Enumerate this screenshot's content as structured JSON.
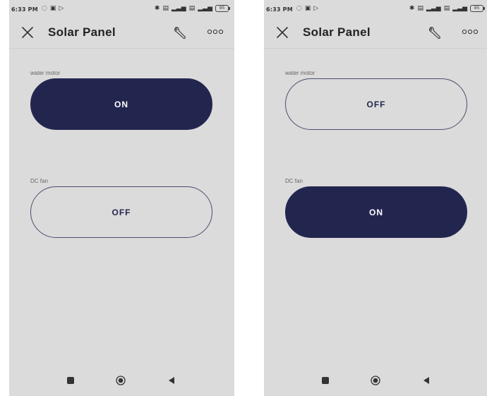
{
  "screens": [
    {
      "status": {
        "time": "6:33 PM",
        "battery": "95"
      },
      "title": "Solar Panel",
      "controls": [
        {
          "label": "water motor",
          "state": "ON"
        },
        {
          "label": "DC fan",
          "state": "OFF"
        }
      ]
    },
    {
      "status": {
        "time": "6:33 PM",
        "battery": "95"
      },
      "title": "Solar Panel",
      "controls": [
        {
          "label": "water motor",
          "state": "OFF"
        },
        {
          "label": "DC fan",
          "state": "ON"
        }
      ]
    }
  ],
  "icons": {
    "close": "close-icon",
    "settings": "wrench-icon",
    "more": "more-icon",
    "nav_recents": "square-icon",
    "nav_home": "home-circle-icon",
    "nav_back": "back-triangle-icon"
  },
  "colors": {
    "screen_bg": "#dbdbdb",
    "toggle_on": "#22264f",
    "toggle_text_on": "#ffffff",
    "toggle_border_off": "#4a4e6e"
  }
}
